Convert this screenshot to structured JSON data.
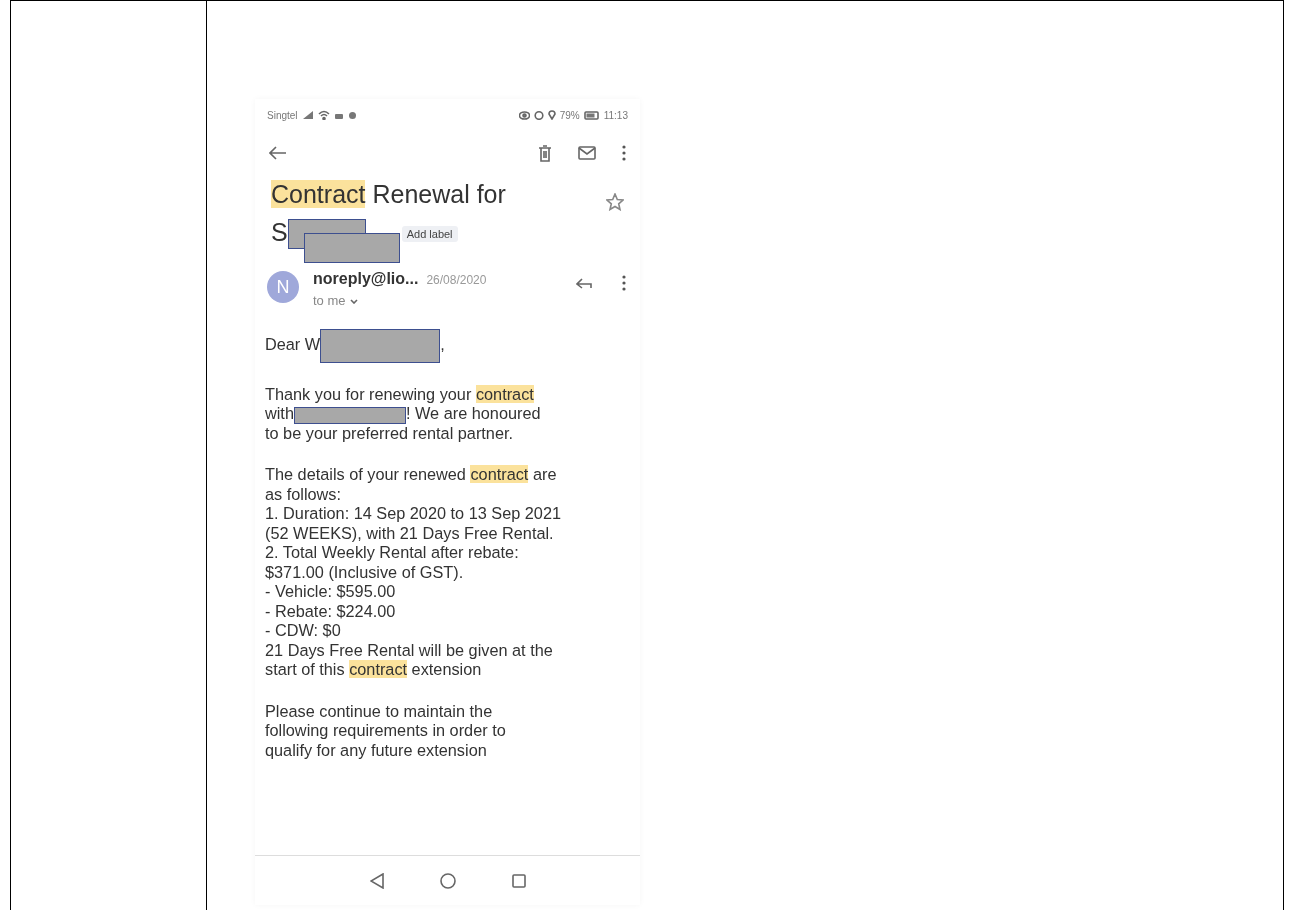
{
  "status_bar": {
    "carrier": "Singtel",
    "battery": "79%",
    "time": "11:13"
  },
  "email": {
    "subject_lines": [
      [
        {
          "text": "Contract",
          "highlight": true
        },
        {
          "text": " Renewal for",
          "highlight": false
        }
      ],
      [
        {
          "text": "S",
          "highlight": false
        },
        {
          "kind": "redacted"
        },
        {
          "kind": "redacted"
        }
      ]
    ],
    "label_chip": "Add label",
    "starred": false,
    "sender": {
      "initial": "N",
      "name": "noreply@lio...",
      "date": "26/08/2020",
      "recipient": "to me"
    },
    "body": [
      [
        [
          {
            "text": "Dear W",
            "highlight": false
          },
          {
            "kind": "redacted"
          },
          {
            "text": ",",
            "highlight": false
          }
        ]
      ],
      [
        [
          {
            "text": "Thank you for renewing your ",
            "highlight": false
          },
          {
            "text": "contract",
            "highlight": true
          }
        ],
        [
          {
            "text": "with",
            "highlight": false
          },
          {
            "kind": "redacted"
          },
          {
            "text": "! We are honoured",
            "highlight": false
          }
        ],
        [
          {
            "text": "to be your preferred rental partner.",
            "highlight": false
          }
        ]
      ],
      [
        [
          {
            "text": "The details of your renewed ",
            "highlight": false
          },
          {
            "text": "contract",
            "highlight": true
          },
          {
            "text": " are",
            "highlight": false
          }
        ],
        [
          {
            "text": "as follows:",
            "highlight": false
          }
        ],
        [
          {
            "text": "1. Duration: 14 Sep 2020 to 13 Sep 2021",
            "highlight": false
          }
        ],
        [
          {
            "text": "(52 WEEKS), with 21 Days Free Rental.",
            "highlight": false
          }
        ],
        [
          {
            "text": "2. Total Weekly Rental after rebate:",
            "highlight": false
          }
        ],
        [
          {
            "text": "$371.00 (Inclusive of GST).",
            "highlight": false
          }
        ],
        [
          {
            "text": "- Vehicle: $595.00",
            "highlight": false
          }
        ],
        [
          {
            "text": "- Rebate: $224.00",
            "highlight": false
          }
        ],
        [
          {
            "text": "- CDW: $0",
            "highlight": false
          }
        ],
        [
          {
            "text": "21 Days Free Rental will be given at the",
            "highlight": false
          }
        ],
        [
          {
            "text": "start of this ",
            "highlight": false
          },
          {
            "text": "contract",
            "highlight": true
          },
          {
            "text": " extension",
            "highlight": false
          }
        ]
      ],
      [
        [
          {
            "text": "Please continue to maintain the",
            "highlight": false
          }
        ],
        [
          {
            "text": "following requirements in order to",
            "highlight": false
          }
        ],
        [
          {
            "text": "qualify for any future extension",
            "highlight": false
          }
        ]
      ]
    ]
  }
}
